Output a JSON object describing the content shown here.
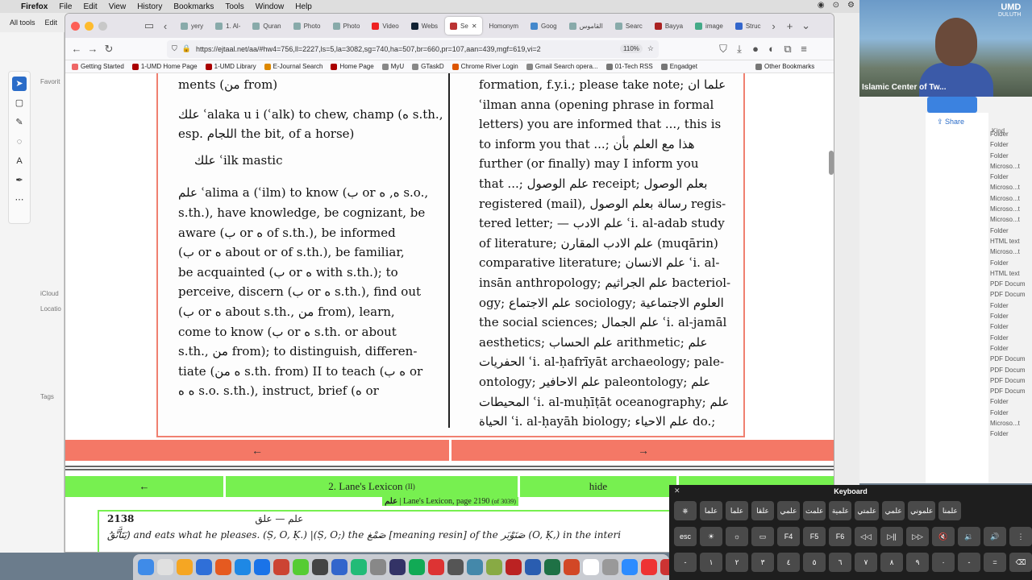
{
  "menubar": {
    "app": "Firefox",
    "items": [
      "File",
      "Edit",
      "View",
      "History",
      "Bookmarks",
      "Tools",
      "Window",
      "Help"
    ]
  },
  "finder": {
    "all_tools": "All tools",
    "edit": "Edit",
    "favorites_label": "Favorit",
    "icloud_label": "iCloud",
    "locations_label": "Locatio",
    "tags_label": "Tags"
  },
  "tabs": [
    {
      "label": "yery"
    },
    {
      "label": "1. Al-"
    },
    {
      "label": "Quran"
    },
    {
      "label": "Photo"
    },
    {
      "label": "Photo"
    },
    {
      "label": "Video"
    },
    {
      "label": "Webs"
    },
    {
      "label": "Se"
    },
    {
      "label": "Homonym"
    },
    {
      "label": "Goog"
    },
    {
      "label": "القاموس"
    },
    {
      "label": "Searc"
    },
    {
      "label": "Bayya"
    },
    {
      "label": "image"
    },
    {
      "label": "Struc"
    }
  ],
  "url": "https://ejtaal.net/aa/#hw4=756,ll=2227,ls=5,la=3082,sg=740,ha=507,br=660,pr=107,aan=439,mgf=619,vi=2",
  "zoom": "110%",
  "bookmarks": [
    "Getting Started",
    "1-UMD Home Page",
    "1-UMD Library",
    "E-Journal Search",
    "Home Page",
    "MyU",
    "GTaskD",
    "Chrome River Login",
    "Gmail Search opera...",
    "01-Tech RSS",
    "Engadget",
    "Other Bookmarks"
  ],
  "scan_left": [
    "ments (من from)",
    "علك ʿalaka u i (ʿalk) to chew, champ (ه s.th.,",
    "esp. اللجام the bit, of a horse)",
    "علك ʿilk mastic",
    "علم ʿalima a (ʿilm) to know (ب or ه, ه s.o.,",
    "s.th.), have knowledge, be cognizant, be",
    "aware (ب or ه of s.th.), be informed",
    "(ب or ه about or of s.th.), be familiar,",
    "be acquainted (ب or ه with s.th.); to",
    "perceive, discern (ب or ه s.th.), find out",
    "(ب or ه about s.th., من from), learn,",
    "come to know (ب or ه s.th. or about",
    "s.th., من from); to distinguish, differen-",
    "tiate (ه من s.th. from) II to teach (ه ب or",
    "ه ه s.o. s.th.), instruct, brief (ه or"
  ],
  "scan_right": [
    "formation, f.y.i.; please take note; علما ان",
    "ʿilman anna (opening phrase in formal",
    "letters) you are informed that ..., this is",
    "to inform you that ...; هذا مع العلم بأن",
    "further (or finally) may I inform you",
    "that ...; علم الوصول receipt; بعلم الوصول",
    "registered (mail), رسالة بعلم الوصول regis-",
    "tered letter; — علم الادب ʿi. al-adab study",
    "of literature; علم الادب المقارن (muqārin)",
    "comparative literature; علم الانسان ʿi. al-",
    "insān anthropology; علم الجراثيم bacteriol-",
    "ogy; علم الاجتماع sociology; العلوم الاجتماعية",
    "the social sciences; علم الجمال ʿi. al-jamāl",
    "aesthetics; علم الحساب arithmetic; علم",
    "الحفريات ʿi. al-ḥafrīyāt archaeology; pale-",
    "ontology; علم الاحافير paleontology; علم",
    "المحيطات ʿi. al-muḥīṭāt oceanography; علم",
    "الحياة ʿi. al-ḥayāh biology; علم الاحياء do.;"
  ],
  "nav": {
    "prev": "←",
    "next": "→"
  },
  "lane": {
    "prev": "←",
    "title": "2. Lane's Lexicon",
    "title_suffix": "(II)",
    "hide": "hide",
    "page_root": "علم",
    "page_text": "| Lane's Lexicon, page 2190",
    "page_of": "(of 3039)",
    "page_number": "2138",
    "heading": "علم — علق",
    "line": "يَتَأَنَّقُ) and eats what he pleases.  (Ṣ, O, Ḳ.)  |(Ṣ, O;) the صَمْغ [meaning resin] of the صَنَوْبَر (O, Ḳ,) in the interi"
  },
  "video": {
    "label": "Islamic Center of Tw...",
    "umd": "UMD",
    "umd_sub": "DULUTH"
  },
  "right_finder": {
    "share": "Share",
    "kind": "Kind",
    "files": [
      "Folder",
      "Folder",
      "Folder",
      "Microso...t",
      "Folder",
      "Microso...t",
      "Microso...t",
      "Microso...t",
      "Microso...t",
      "Folder",
      "HTML text",
      "Microso...t",
      "Folder",
      "HTML text",
      "PDF Docum",
      "PDF Docum",
      "Folder",
      "Folder",
      "Folder",
      "Folder",
      "Folder",
      "PDF Docum",
      "PDF Docum",
      "PDF Docum",
      "PDF Docum",
      "Folder",
      "Folder",
      "Microso...t",
      "Folder"
    ]
  },
  "keyboard": {
    "title": "Keyboard",
    "suggestions": [
      "علما",
      "علما",
      "علقا",
      "علمي",
      "علمت",
      "علمية",
      "علمتي",
      "علمي",
      "علموني",
      "علمنا"
    ],
    "fn_row": [
      "esc",
      "☀",
      "☼",
      "▭",
      "F4",
      "F5",
      "F6",
      "◁◁",
      "▷||",
      "▷▷",
      "🔇",
      "🔉",
      "🔊",
      "⋮"
    ],
    "num_row": [
      "-",
      "١",
      "٢",
      "٣",
      "٤",
      "٥",
      "٦",
      "٧",
      "٨",
      "٩",
      "٠",
      "-",
      "=",
      "⌫"
    ]
  }
}
